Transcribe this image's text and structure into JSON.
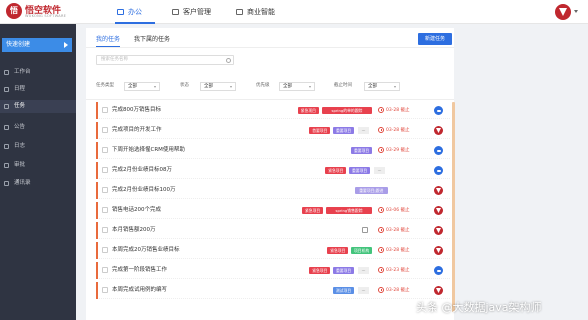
{
  "header": {
    "brand": "悟空软件",
    "brand_sub": "WUKONG SOFTWARE",
    "nav": [
      {
        "label": "办公",
        "active": true
      },
      {
        "label": "客户管理",
        "active": false
      },
      {
        "label": "商业智能",
        "active": false
      }
    ]
  },
  "sidebar": {
    "quick": "快速创建",
    "items": [
      {
        "label": "工作台",
        "active": false
      },
      {
        "label": "日程",
        "active": false
      },
      {
        "label": "任务",
        "active": true
      },
      {
        "label": "公告",
        "active": false
      },
      {
        "label": "日志",
        "active": false
      },
      {
        "label": "审批",
        "active": false
      },
      {
        "label": "通讯录",
        "active": false
      }
    ]
  },
  "main": {
    "tabs": [
      {
        "label": "我的任务",
        "active": true
      },
      {
        "label": "我下属的任务",
        "active": false
      }
    ],
    "new_task": "新建任务",
    "search_placeholder": "搜索任务名称",
    "filters": [
      {
        "label": "任务类型",
        "value": "全部"
      },
      {
        "label": "状态",
        "value": "全部"
      },
      {
        "label": "优先级",
        "value": "全部"
      },
      {
        "label": "截止时间",
        "value": "全部"
      }
    ],
    "tasks": [
      {
        "title": "完成800万销售目标",
        "tags": [
          {
            "text": "紧急项目",
            "color": "#e8414e"
          },
          {
            "text": "spring的单的跟踪",
            "color": "#e8414e"
          }
        ],
        "due": "03-28 截止",
        "icon": "blue"
      },
      {
        "title": "完成项目的开发工作",
        "tags": [
          {
            "text": "首要项目",
            "color": "#e8414e"
          },
          {
            "text": "重要项目",
            "color": "#8c7ae6"
          }
        ],
        "more": "…",
        "due": "03-28 截止",
        "icon": "red"
      },
      {
        "title": "下周开始选择惺CRM使用帮助",
        "tags": [
          {
            "text": "重要项目",
            "color": "#8c7ae6"
          }
        ],
        "due": "03-29 截止",
        "icon": "blue"
      },
      {
        "title": "完成2月份业绩目标08万",
        "tags": [
          {
            "text": "紧急项目",
            "color": "#e8414e"
          },
          {
            "text": "重要项目",
            "color": "#8c7ae6"
          }
        ],
        "more": "…",
        "due": "",
        "icon": "blue"
      },
      {
        "title": "完成2月份业绩目标100万",
        "tags": [
          {
            "text": "重要项目|跟进",
            "color": "#a99de8"
          }
        ],
        "due": "",
        "icon": "red"
      },
      {
        "title": "销售电话200个完成",
        "tags": [
          {
            "text": "紧急项目",
            "color": "#e8414e"
          },
          {
            "text": "spring销售跟踪",
            "color": "#e8414e"
          }
        ],
        "due": "03-06 截止",
        "icon": "red"
      },
      {
        "title": "本月销售额200万",
        "tags": [],
        "comment": true,
        "due": "03-28 截止",
        "icon": "red"
      },
      {
        "title": "本周完成20万销售业绩目标",
        "tags": [
          {
            "text": "紧急项目",
            "color": "#e8414e"
          },
          {
            "text": "项目机构",
            "color": "#43c47c"
          }
        ],
        "due": "03-28 截止",
        "icon": "red"
      },
      {
        "title": "完成第一阶段销售工作",
        "tags": [
          {
            "text": "紧急项目",
            "color": "#e8414e"
          },
          {
            "text": "重要项目",
            "color": "#8c7ae6"
          }
        ],
        "more": "…",
        "due": "03-23 截止",
        "icon": "blue"
      },
      {
        "title": "本周完成试用例的编写",
        "tags": [
          {
            "text": "测试项目",
            "color": "#5a8fe6"
          }
        ],
        "more": "…",
        "due": "03-28 截止",
        "icon": "red"
      }
    ]
  },
  "watermark": "头条 @大数据java架构师"
}
